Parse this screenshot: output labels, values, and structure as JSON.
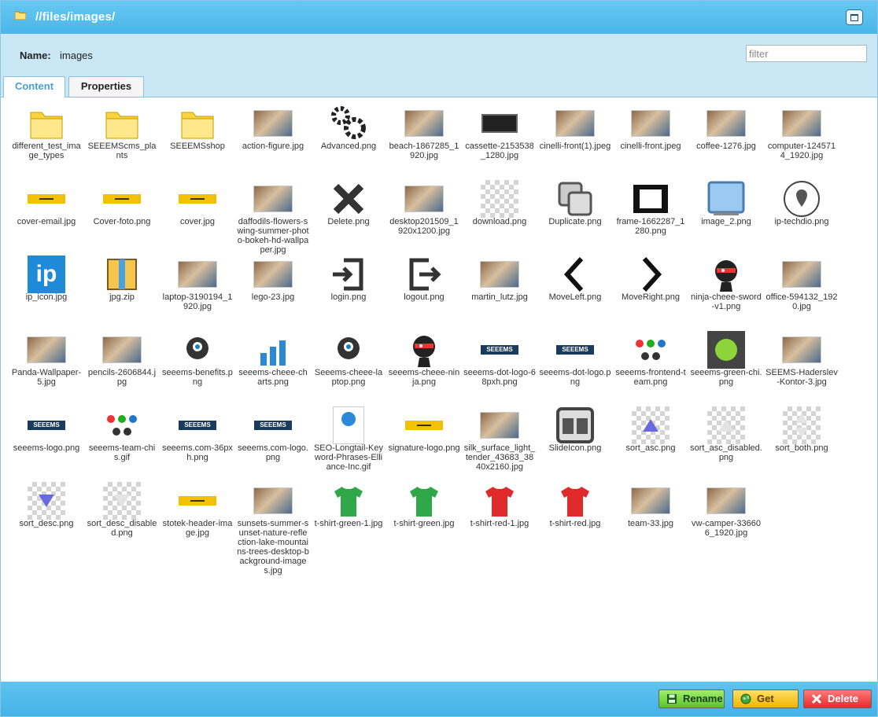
{
  "window": {
    "title": "//files/images/"
  },
  "header": {
    "name_label": "Name:",
    "name_value": "images",
    "filter_placeholder": "filter"
  },
  "tabs": [
    {
      "label": "Content",
      "active": true
    },
    {
      "label": "Properties",
      "active": false
    }
  ],
  "files": [
    {
      "name": "different_test_image_types",
      "icon": "folder-icon"
    },
    {
      "name": "SEEEMScms_plants",
      "icon": "folder-icon"
    },
    {
      "name": "SEEEMSshop",
      "icon": "folder-icon"
    },
    {
      "name": "action-figure.jpg",
      "icon": "photo-thumbnail"
    },
    {
      "name": "Advanced.png",
      "icon": "gears-icon"
    },
    {
      "name": "beach-1867285_1920.jpg",
      "icon": "photo-thumbnail"
    },
    {
      "name": "cassette-2153538_1280.jpg",
      "icon": "cassette-thumbnail"
    },
    {
      "name": "cinelli-front(1).jpeg",
      "icon": "photo-thumbnail"
    },
    {
      "name": "cinelli-front.jpeg",
      "icon": "photo-thumbnail"
    },
    {
      "name": "coffee-1276.jpg",
      "icon": "photo-thumbnail"
    },
    {
      "name": "computer-1245714_1920.jpg",
      "icon": "photo-thumbnail"
    },
    {
      "name": "cover-email.jpg",
      "icon": "banner-thumbnail"
    },
    {
      "name": "Cover-foto.png",
      "icon": "banner-thumbnail"
    },
    {
      "name": "cover.jpg",
      "icon": "banner-thumbnail"
    },
    {
      "name": "daffodils-flowers-swing-summer-photo-bokeh-hd-wallpaper.jpg",
      "icon": "photo-thumbnail"
    },
    {
      "name": "Delete.png",
      "icon": "x-icon"
    },
    {
      "name": "desktop201509_1920x1200.jpg",
      "icon": "photo-thumbnail"
    },
    {
      "name": "download.png",
      "icon": "transparent-thumbnail"
    },
    {
      "name": "Duplicate.png",
      "icon": "duplicate-icon"
    },
    {
      "name": "frame-1662287_1280.png",
      "icon": "film-frame-icon"
    },
    {
      "name": "image_2.png",
      "icon": "monitor-icon"
    },
    {
      "name": "ip-techdio.png",
      "icon": "map-pin-icon"
    },
    {
      "name": "ip_icon.jpg",
      "icon": "ip-logo-icon"
    },
    {
      "name": "jpg.zip",
      "icon": "zip-archive-icon"
    },
    {
      "name": "laptop-3190194_1920.jpg",
      "icon": "photo-thumbnail"
    },
    {
      "name": "lego-23.jpg",
      "icon": "photo-thumbnail"
    },
    {
      "name": "login.png",
      "icon": "login-icon"
    },
    {
      "name": "logout.png",
      "icon": "logout-icon"
    },
    {
      "name": "martin_lutz.jpg",
      "icon": "photo-thumbnail"
    },
    {
      "name": "MoveLeft.png",
      "icon": "chevron-left-icon"
    },
    {
      "name": "MoveRight.png",
      "icon": "chevron-right-icon"
    },
    {
      "name": "ninja-cheee-sword-v1.png",
      "icon": "ninja-mascot-icon"
    },
    {
      "name": "office-594132_1920.jpg",
      "icon": "photo-thumbnail"
    },
    {
      "name": "Panda-Wallpaper-5.jpg",
      "icon": "photo-thumbnail"
    },
    {
      "name": "pencils-2606844.jpg",
      "icon": "photo-thumbnail"
    },
    {
      "name": "seeems-benefits.png",
      "icon": "mascot-icon"
    },
    {
      "name": "seeems-cheee-charts.png",
      "icon": "mascot-chart-icon"
    },
    {
      "name": "Seeems-cheee-laptop.png",
      "icon": "mascot-icon"
    },
    {
      "name": "seeems-cheee-ninja.png",
      "icon": "ninja-mascot-icon"
    },
    {
      "name": "seeems-dot-logo-68pxh.png",
      "icon": "seeems-logo-icon"
    },
    {
      "name": "seeems-dot-logo.png",
      "icon": "seeems-logo-icon"
    },
    {
      "name": "seeems-frontend-team.png",
      "icon": "team-mascots-icon"
    },
    {
      "name": "seeems-green-chi.png",
      "icon": "green-mascot-icon"
    },
    {
      "name": "SEEMS-Haderslev-Kontor-3.jpg",
      "icon": "photo-thumbnail"
    },
    {
      "name": "seeems-logo.png",
      "icon": "seeems-logo-icon"
    },
    {
      "name": "seeems-team-chis.gif",
      "icon": "team-mascots-icon"
    },
    {
      "name": "seeems.com-36pxh.png",
      "icon": "seeems-logo-icon"
    },
    {
      "name": "seeems.com-logo.png",
      "icon": "seeems-logo-icon"
    },
    {
      "name": "SEO-Longtail-Keyword-Phrases-Elliance-Inc.gif",
      "icon": "infographic-thumbnail"
    },
    {
      "name": "signature-logo.png",
      "icon": "banner-thumbnail"
    },
    {
      "name": "silk_surface_light_tender_43683_3840x2160.jpg",
      "icon": "photo-thumbnail"
    },
    {
      "name": "SlideIcon.png",
      "icon": "slides-icon"
    },
    {
      "name": "sort_asc.png",
      "icon": "sort-asc-icon"
    },
    {
      "name": "sort_asc_disabled.png",
      "icon": "sort-asc-disabled-icon"
    },
    {
      "name": "sort_both.png",
      "icon": "sort-both-icon"
    },
    {
      "name": "sort_desc.png",
      "icon": "sort-desc-icon"
    },
    {
      "name": "sort_desc_disabled.png",
      "icon": "sort-desc-disabled-icon"
    },
    {
      "name": "stotek-header-image.jpg",
      "icon": "banner-thumbnail"
    },
    {
      "name": "sunsets-summer-sunset-nature-reflection-lake-mountains-trees-desktop-background-images.jpg",
      "icon": "photo-thumbnail"
    },
    {
      "name": "t-shirt-green-1.jpg",
      "icon": "green-tshirt-icon"
    },
    {
      "name": "t-shirt-green.jpg",
      "icon": "green-tshirt-icon"
    },
    {
      "name": "t-shirt-red-1.jpg",
      "icon": "red-tshirt-icon"
    },
    {
      "name": "t-shirt-red.jpg",
      "icon": "red-tshirt-icon"
    },
    {
      "name": "team-33.jpg",
      "icon": "photo-thumbnail"
    },
    {
      "name": "vw-camper-336606_1920.jpg",
      "icon": "photo-thumbnail"
    }
  ],
  "buttons": {
    "rename": "Rename",
    "get": "Get",
    "delete": "Delete"
  },
  "colors": {
    "titlebar": "#4bb6ea",
    "accent_tab": "#4b9fd3",
    "rename": "#5cc228",
    "get": "#f0b400",
    "delete": "#e62a2a"
  }
}
